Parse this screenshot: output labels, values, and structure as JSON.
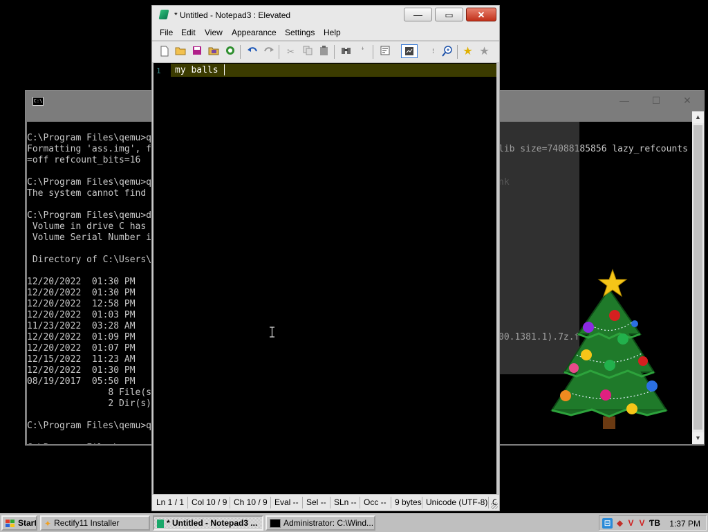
{
  "console": {
    "title": "",
    "controls": {
      "minimize": "—",
      "maximize": "☐",
      "close": "✕"
    },
    "lines": [
      "",
      "C:\\Program Files\\qemu>q",
      "Formatting 'ass.img', f",
      "=off refcount_bits=16",
      "",
      "C:\\Program Files\\qemu>q",
      "The system cannot find",
      "",
      "C:\\Program Files\\qemu>d",
      " Volume in drive C has",
      " Volume Serial Number i",
      "",
      " Directory of C:\\Users\\",
      "",
      "12/20/2022  01:30 PM",
      "12/20/2022  01:30 PM",
      "12/20/2022  12:58 PM",
      "12/20/2022  01:03 PM",
      "11/23/2022  03:28 AM",
      "12/20/2022  01:09 PM",
      "12/20/2022  01:07 PM",
      "12/15/2022  11:23 AM",
      "12/20/2022  01:30 PM",
      "08/19/2017  05:50 PM",
      "               8 File(s",
      "               2 Dir(s)",
      "",
      "C:\\Program Files\\qemu>q",
      "",
      "C:\\Program Files\\qemu>"
    ],
    "right_fragments": [
      {
        "text": "lib size=74088185856 lazy_refcounts",
        "row": 2,
        "faded": false
      },
      {
        "text": "nk",
        "row": 5,
        "faded": true
      },
      {
        "text": "00.1381.1).7z.f",
        "row": 19,
        "faded": false
      }
    ]
  },
  "notepad": {
    "title": "* Untitled - Notepad3 : Elevated",
    "controls": {
      "minimize": "—",
      "maximize": "▭",
      "close": "✕"
    },
    "menu": [
      "File",
      "Edit",
      "View",
      "Appearance",
      "Settings",
      "Help"
    ],
    "toolbar_icons": [
      "new-file-icon",
      "open-folder-icon",
      "save-icon",
      "save-as-icon",
      "browse-icon",
      "undo-icon",
      "redo-icon",
      "cut-icon",
      "copy-icon",
      "paste-icon",
      "find-icon",
      "replace-icon",
      "wordwrap-icon",
      "zoom-icon",
      "zoom-in-icon",
      "favorite-icon",
      "add-favorite-icon"
    ],
    "line_number": "1",
    "content": "my balls ",
    "status": {
      "ln": "Ln  1 / 1",
      "col": "Col  10 / 9",
      "ch": "Ch  10 / 9",
      "eval": "Eval  --",
      "sel": "Sel  --",
      "sln": "SLn  --",
      "occ": "Occ  --",
      "size": "9 bytes",
      "encoding": "Unicode (UTF-8)",
      "eol": "C"
    }
  },
  "taskbar": {
    "start_label": "Start",
    "buttons": [
      {
        "label": "Rectify11 Installer",
        "icon": "installer-icon"
      },
      {
        "label": "* Untitled - Notepad3 ...",
        "icon": "notepad3-icon",
        "active": true
      },
      {
        "label": "Administrator: C:\\Wind...",
        "icon": "console-icon"
      }
    ],
    "clock": "1:37 PM"
  },
  "colors": {
    "desktop": "#000000",
    "editor_bg": "#000000",
    "current_line": "#3b3b00",
    "line_number": "#3a8a8a",
    "close_button": "#c1311a",
    "taskbar": "#bfbfbf"
  }
}
